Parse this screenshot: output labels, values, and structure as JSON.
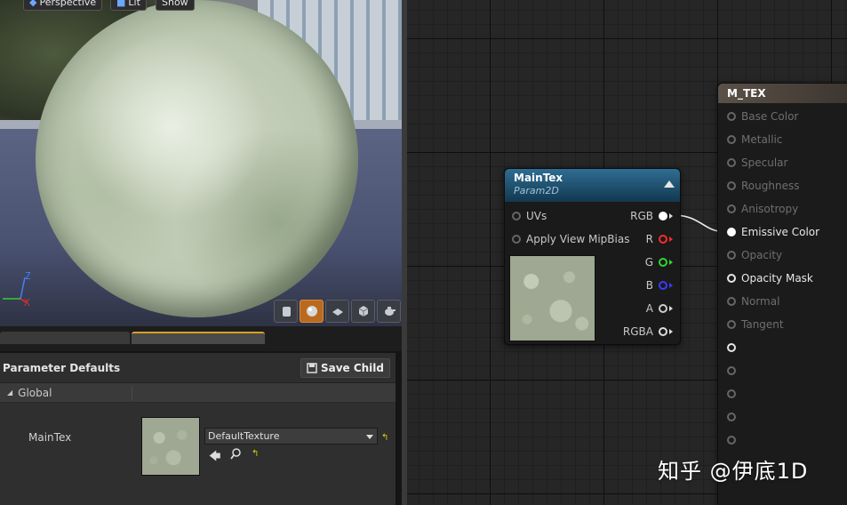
{
  "viewport": {
    "buttons": [
      {
        "label": "Perspective",
        "icon": "perspective-icon"
      },
      {
        "label": "Lit",
        "icon": "lit-icon"
      },
      {
        "label": "Show",
        "icon": ""
      }
    ],
    "axes": {
      "z": "Z",
      "x": "X"
    },
    "tools": [
      "cylinder-preview-icon",
      "sphere-preview-icon",
      "plane-preview-icon",
      "cube-preview-icon",
      "teapot-preview-icon"
    ]
  },
  "parameter_panel": {
    "title": "Parameter Defaults",
    "save_child_label": "Save Child",
    "group_label": "Global",
    "param_name": "MainTex",
    "texture_value": "DefaultTexture"
  },
  "nodes": {
    "maintex": {
      "title": "MainTex",
      "subtitle": "Param2D",
      "inputs": [
        "UVs",
        "Apply View MipBias"
      ],
      "outputs": [
        {
          "label": "RGB",
          "color": "#ffffff"
        },
        {
          "label": "R",
          "color": "#ff2a2a"
        },
        {
          "label": "G",
          "color": "#2cd92c"
        },
        {
          "label": "B",
          "color": "#3a3aff"
        },
        {
          "label": "A",
          "color": "#cccccc"
        },
        {
          "label": "RGBA",
          "color": "#ffffff"
        }
      ]
    },
    "material": {
      "title": "M_TEX",
      "pins": [
        {
          "label": "Base Color",
          "active": false
        },
        {
          "label": "Metallic",
          "active": false
        },
        {
          "label": "Specular",
          "active": false
        },
        {
          "label": "Roughness",
          "active": false
        },
        {
          "label": "Anisotropy",
          "active": false
        },
        {
          "label": "Emissive Color",
          "active": true,
          "connected": true
        },
        {
          "label": "Opacity",
          "active": false
        },
        {
          "label": "Opacity Mask",
          "active": true
        },
        {
          "label": "Normal",
          "active": false
        },
        {
          "label": "Tangent",
          "active": false
        },
        {
          "label": "",
          "active": true
        },
        {
          "label": "",
          "active": false
        },
        {
          "label": "",
          "active": false
        },
        {
          "label": "",
          "active": false
        },
        {
          "label": "",
          "active": false
        }
      ]
    }
  },
  "watermark": "知乎 @伊底1D"
}
